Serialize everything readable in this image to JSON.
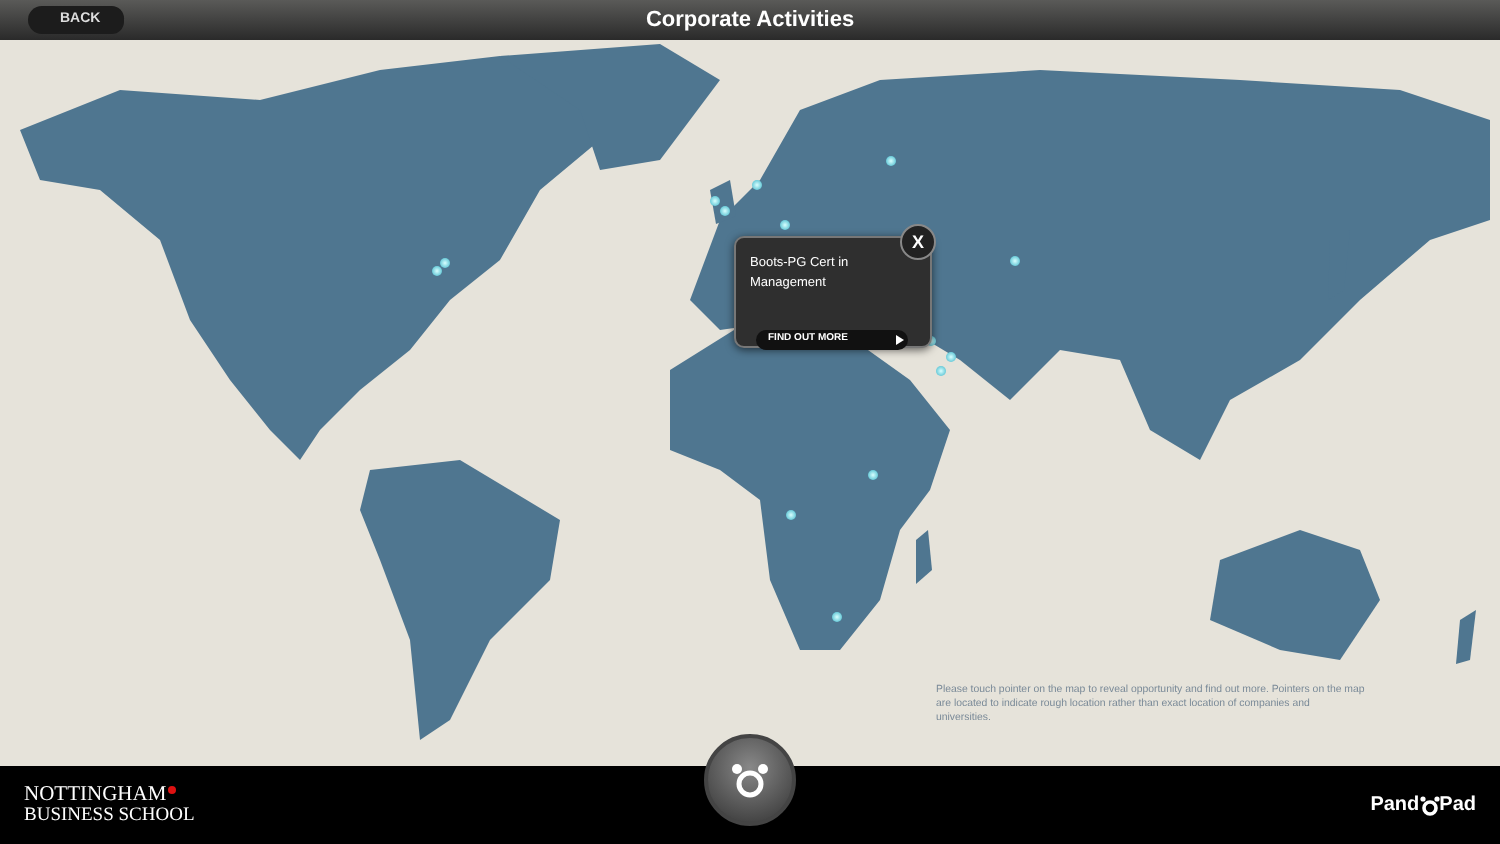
{
  "top_bar": {
    "back_button": "BACK",
    "title": "Corporate Activities"
  },
  "popup": {
    "title": "Boots-PG Cert in Management",
    "close": "X",
    "link": "FIND OUT MORE"
  },
  "help_text": "Please touch pointer on the map to reveal opportunity and find out more. Pointers on the map are located to indicate rough location rather than exact location of companies and universities.",
  "bottom_bar": {
    "logo_line_1": "NOTTINGHAM",
    "logo_line_2": "BUSINESS SCHOOL",
    "brand_left": "Pand",
    "brand_right": "Pad"
  }
}
